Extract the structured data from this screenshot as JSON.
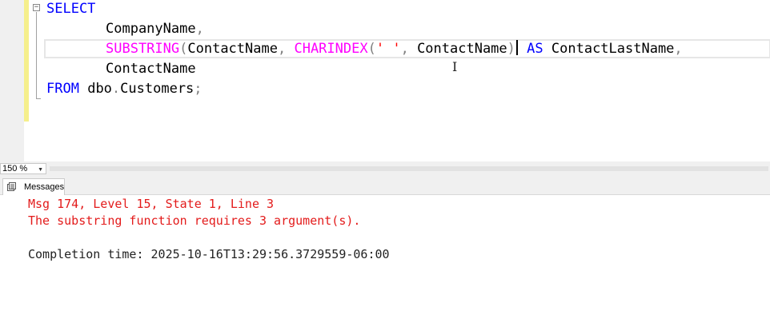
{
  "editor": {
    "line1": {
      "kw": "SELECT"
    },
    "line2": {
      "text": "CompanyName",
      "comma": ","
    },
    "line3": {
      "fn1": "SUBSTRING",
      "p1": "(",
      "arg1": "ContactName",
      "c1": ",",
      "fn2": "CHARINDEX",
      "p2": "(",
      "str": "' '",
      "c2": ",",
      "arg2": "ContactName",
      "p3": ")",
      "kw_as": "AS",
      "alias": "ContactLastName",
      "c3": ","
    },
    "line4": {
      "text": "ContactName"
    },
    "line5": {
      "kw": "FROM",
      "schema": "dbo",
      "dot": ".",
      "table": "Customers",
      "semi": ";"
    },
    "fold_glyph": "−"
  },
  "status": {
    "zoom": "150 %",
    "zoom_arrow": "▼"
  },
  "results": {
    "tab_label": "Messages",
    "error_line1": "Msg 174, Level 15, State 1, Line 3",
    "error_line2": "The substring function requires 3 argument(s).",
    "completion": "Completion time: 2025-10-16T13:29:56.3729559-06:00"
  },
  "colors": {
    "keyword": "#0000ff",
    "function": "#ff00ff",
    "string": "#ff0000",
    "operator": "#808080",
    "error": "#e31b1b"
  }
}
